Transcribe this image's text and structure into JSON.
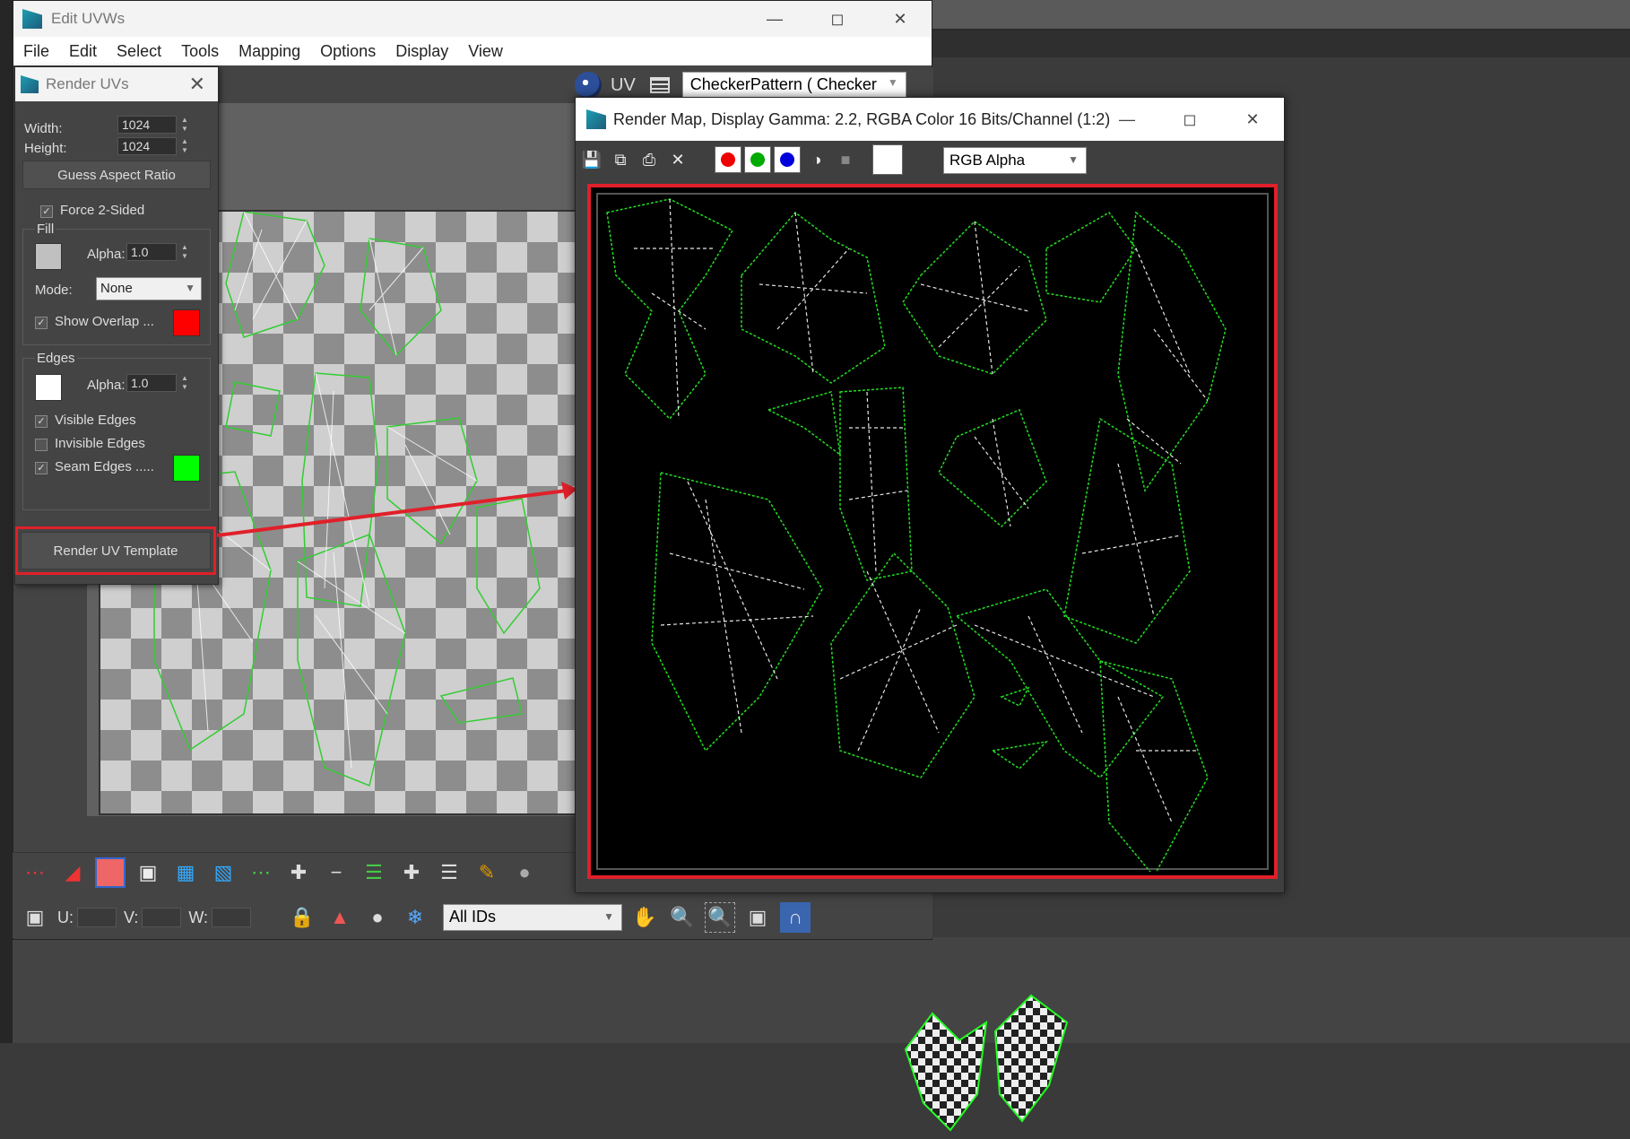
{
  "edit_uvw": {
    "title": "Edit UVWs",
    "menu": [
      "File",
      "Edit",
      "Select",
      "Tools",
      "Mapping",
      "Options",
      "Display",
      "View"
    ],
    "uv_label": "UV",
    "texture_select": "CheckerPattern  ( Checker",
    "bottom": {
      "u_label": "U:",
      "v_label": "V:",
      "w_label": "W:",
      "ids_select": "All IDs"
    }
  },
  "render_uvs": {
    "title": "Render UVs",
    "width_label": "Width:",
    "width_value": "1024",
    "height_label": "Height:",
    "height_value": "1024",
    "guess_aspect_button": "Guess Aspect Ratio",
    "force_2_sided": "Force 2-Sided",
    "fill_group": "Fill",
    "fill_alpha_label": "Alpha:",
    "fill_alpha_value": "1.0",
    "mode_label": "Mode:",
    "mode_value": "None",
    "show_overlap": "Show Overlap ...",
    "edges_group": "Edges",
    "edges_alpha_label": "Alpha:",
    "edges_alpha_value": "1.0",
    "visible_edges": "Visible Edges",
    "invisible_edges": "Invisible Edges",
    "seam_edges": "Seam Edges .....",
    "render_button": "Render UV Template",
    "colors": {
      "fill_swatch": "#c0c0c0",
      "overlap_swatch": "#ff0000",
      "edges_swatch": "#ffffff",
      "seam_swatch": "#00ff00",
      "highlight": "#e0202a"
    }
  },
  "render_map": {
    "title": "Render Map, Display Gamma: 2.2, RGBA Color 16 Bits/Channel (1:2)",
    "channel_select": "RGB Alpha",
    "channel_colors": [
      "#ff0000",
      "#00a000",
      "#0000ff"
    ]
  },
  "icons": {
    "minimize": "minimize-icon",
    "maximize": "maximize-icon",
    "close": "close-icon"
  }
}
